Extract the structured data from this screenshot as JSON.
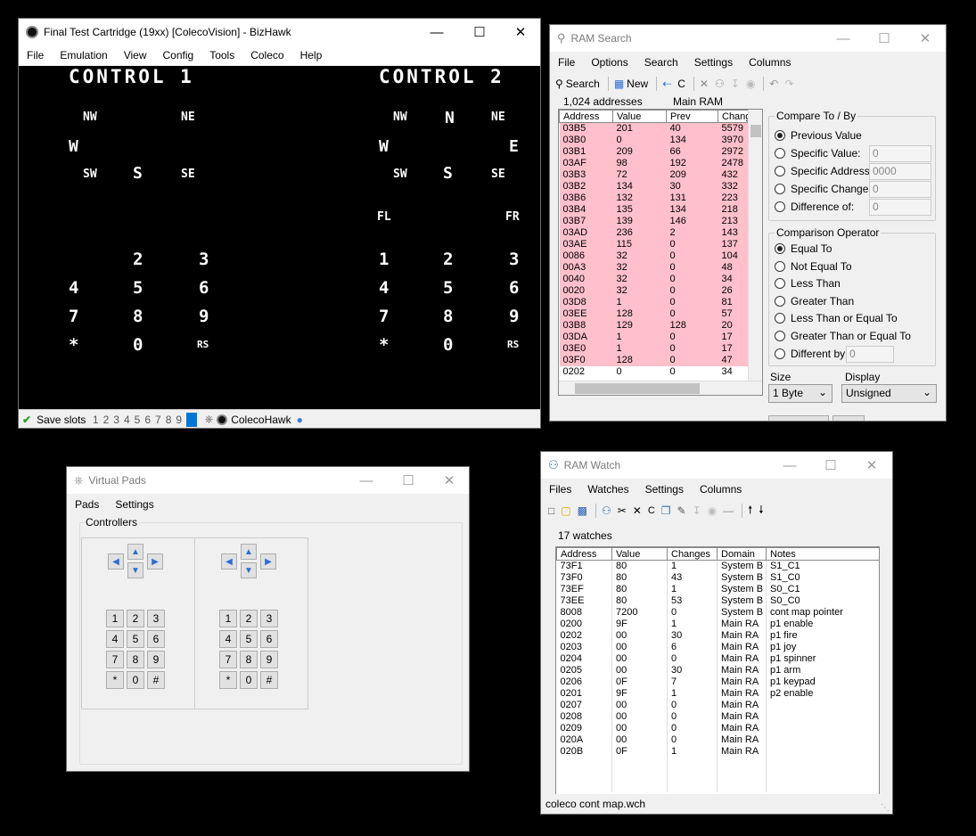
{
  "bizhawk": {
    "title": "Final Test Cartridge (19xx) [ColecoVision] - BizHawk",
    "menu": [
      "File",
      "Emulation",
      "View",
      "Config",
      "Tools",
      "Coleco",
      "Help"
    ],
    "screen": {
      "control1": "CONTROL 1",
      "control2": "CONTROL 2",
      "p1_dirs": {
        "nw": "NW",
        "ne": "NE",
        "w": "W",
        "sw": "SW",
        "s": "S",
        "se": "SE"
      },
      "p2_dirs": {
        "nw": "NW",
        "n": "N",
        "ne": "NE",
        "w": "W",
        "e": "E",
        "sw": "SW",
        "s": "S",
        "se": "SE",
        "fl": "FL",
        "fr": "FR"
      },
      "p1_keys": {
        "k2": "2",
        "k3": "3",
        "k4": "4",
        "k5": "5",
        "k6": "6",
        "k7": "7",
        "k8": "8",
        "k9": "9",
        "star": "*",
        "k0": "0",
        "rs": "RS"
      },
      "p2_keys": {
        "k1": "1",
        "k2": "2",
        "k3": "3",
        "k4": "4",
        "k5": "5",
        "k6": "6",
        "k7": "7",
        "k8": "8",
        "k9": "9",
        "star": "*",
        "k0": "0",
        "rs": "RS"
      }
    },
    "status": {
      "save_slots_label": "Save slots",
      "slots": [
        "1",
        "2",
        "3",
        "4",
        "5",
        "6",
        "7",
        "8",
        "9",
        "0"
      ],
      "core": "ColecoHawk"
    }
  },
  "ram_search": {
    "title": "RAM Search",
    "menu": [
      "File",
      "Options",
      "Search",
      "Settings",
      "Columns"
    ],
    "toolbar": {
      "search": "Search",
      "new": "New",
      "c": "C"
    },
    "address_count": "1,024 addresses",
    "domain": "Main RAM",
    "columns": [
      "Address",
      "Value",
      "Prev",
      "Changes"
    ],
    "rows": [
      [
        "03B5",
        "201",
        "40",
        "5579"
      ],
      [
        "03B0",
        "0",
        "134",
        "3970"
      ],
      [
        "03B1",
        "209",
        "66",
        "2972"
      ],
      [
        "03AF",
        "98",
        "192",
        "2478"
      ],
      [
        "03B3",
        "72",
        "209",
        "432"
      ],
      [
        "03B2",
        "134",
        "30",
        "332"
      ],
      [
        "03B6",
        "132",
        "131",
        "223"
      ],
      [
        "03B4",
        "135",
        "134",
        "218"
      ],
      [
        "03B7",
        "139",
        "146",
        "213"
      ],
      [
        "03AD",
        "236",
        "2",
        "143"
      ],
      [
        "03AE",
        "115",
        "0",
        "137"
      ],
      [
        "0086",
        "32",
        "0",
        "104"
      ],
      [
        "00A3",
        "32",
        "0",
        "48"
      ],
      [
        "0040",
        "32",
        "0",
        "34"
      ],
      [
        "0020",
        "32",
        "0",
        "26"
      ],
      [
        "03D8",
        "1",
        "0",
        "81"
      ],
      [
        "03EE",
        "128",
        "0",
        "57"
      ],
      [
        "03B8",
        "129",
        "128",
        "20"
      ],
      [
        "03DA",
        "1",
        "0",
        "17"
      ],
      [
        "03E0",
        "1",
        "0",
        "17"
      ],
      [
        "03F0",
        "128",
        "0",
        "47"
      ],
      [
        "0202",
        "0",
        "0",
        "34"
      ]
    ],
    "compare_to": {
      "label": "Compare To / By",
      "options": [
        "Previous Value",
        "Specific Value:",
        "Specific Address:",
        "Specific Changes:",
        "Difference of:"
      ],
      "selected": 0,
      "fields": [
        "0",
        "0000",
        "0",
        "0"
      ]
    },
    "comparison_operator": {
      "label": "Comparison Operator",
      "options": [
        "Equal To",
        "Not Equal To",
        "Less Than",
        "Greater Than",
        "Less Than or Equal To",
        "Greater Than or Equal To",
        "Different by:"
      ],
      "selected": 0,
      "different_by": "0"
    },
    "size": {
      "label": "Size",
      "value": "1 Byte"
    },
    "display": {
      "label": "Display",
      "value": "Unsigned"
    }
  },
  "virtual_pads": {
    "title": "Virtual Pads",
    "menu": [
      "Pads",
      "Settings"
    ],
    "group": "Controllers",
    "keys": [
      "1",
      "2",
      "3",
      "4",
      "5",
      "6",
      "7",
      "8",
      "9",
      "*",
      "0",
      "#"
    ]
  },
  "ram_watch": {
    "title": "RAM Watch",
    "menu": [
      "Files",
      "Watches",
      "Settings",
      "Columns"
    ],
    "toolbar": {
      "c": "C"
    },
    "count": "17 watches",
    "columns": [
      "Address",
      "Value",
      "Changes",
      "Domain",
      "Notes"
    ],
    "rows": [
      [
        "73F1",
        "80",
        "1",
        "System B",
        "S1_C1"
      ],
      [
        "73F0",
        "80",
        "43",
        "System B",
        "S1_C0"
      ],
      [
        "73EF",
        "80",
        "1",
        "System B",
        "S0_C1"
      ],
      [
        "73EE",
        "80",
        "53",
        "System B",
        "S0_C0"
      ],
      [
        "8008",
        "7200",
        "0",
        "System B",
        "cont map pointer"
      ],
      [
        "0200",
        "9F",
        "1",
        "Main RA",
        "p1 enable"
      ],
      [
        "0202",
        "00",
        "30",
        "Main RA",
        "p1 fire"
      ],
      [
        "0203",
        "00",
        "6",
        "Main RA",
        "p1 joy"
      ],
      [
        "0204",
        "00",
        "0",
        "Main RA",
        "p1 spinner"
      ],
      [
        "0205",
        "00",
        "30",
        "Main RA",
        "p1 arm"
      ],
      [
        "0206",
        "0F",
        "7",
        "Main RA",
        "p1 keypad"
      ],
      [
        "0201",
        "9F",
        "1",
        "Main RA",
        "p2 enable"
      ],
      [
        "0207",
        "00",
        "0",
        "Main RA",
        ""
      ],
      [
        "0208",
        "00",
        "0",
        "Main RA",
        ""
      ],
      [
        "0209",
        "00",
        "0",
        "Main RA",
        ""
      ],
      [
        "020A",
        "00",
        "0",
        "Main RA",
        ""
      ],
      [
        "020B",
        "0F",
        "1",
        "Main RA",
        ""
      ]
    ],
    "status": "coleco cont map.wch"
  },
  "colors": {
    "pink_row": "#ffc0cb",
    "accent": "#0078d7",
    "screen_bg": "#000000",
    "screen_fg": "#ffffff"
  }
}
